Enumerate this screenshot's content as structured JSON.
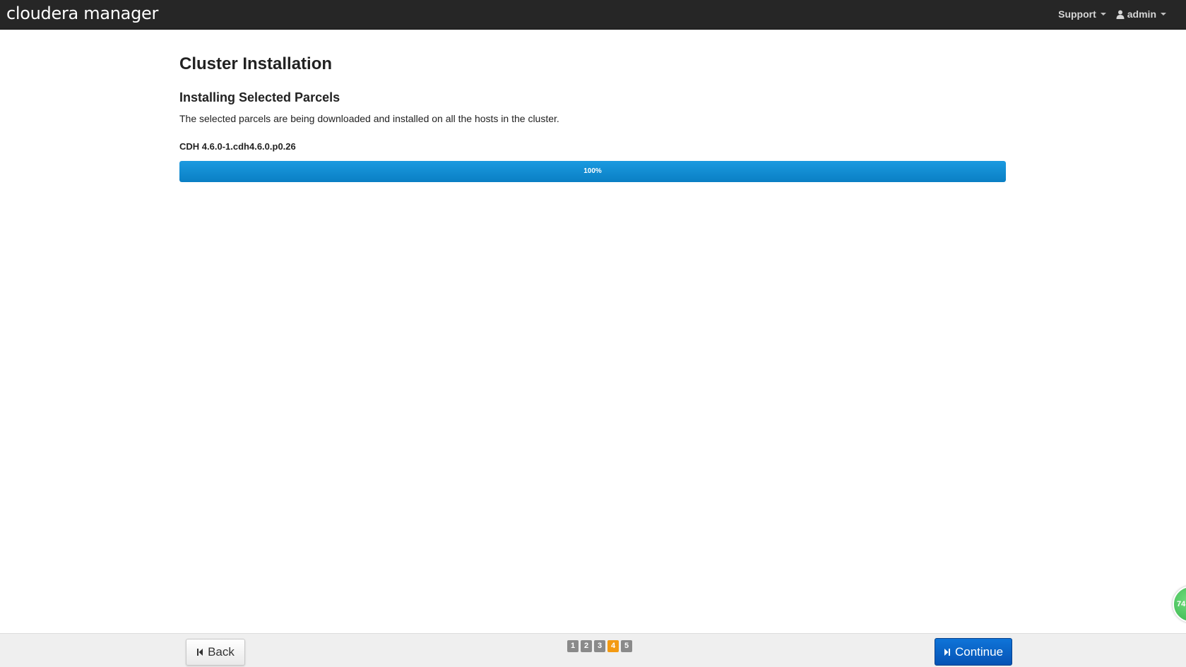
{
  "header": {
    "brand": "cloudera manager",
    "support_label": "Support",
    "user_label": "admin"
  },
  "main": {
    "title": "Cluster Installation",
    "section_title": "Installing Selected Parcels",
    "description": "The selected parcels are being downloaded and installed on all the hosts in the cluster.",
    "parcel": {
      "name": "CDH 4.6.0-1.cdh4.6.0.p0.26",
      "progress_label": "100%",
      "progress_value": 100
    }
  },
  "footer": {
    "back_label": "Back",
    "continue_label": "Continue",
    "steps": [
      "1",
      "2",
      "3",
      "4",
      "5"
    ],
    "active_step": 4
  },
  "side_widget": {
    "label": "74"
  },
  "colors": {
    "topbar": "#262626",
    "progress": "#1190d6",
    "continue": "#0a63c6",
    "active_step": "#f39a12",
    "inactive_step": "#8a8a8a"
  },
  "icons": {
    "user": "user-icon",
    "back": "step-backward-icon",
    "continue": "step-forward-icon",
    "caret": "caret-down-icon"
  }
}
